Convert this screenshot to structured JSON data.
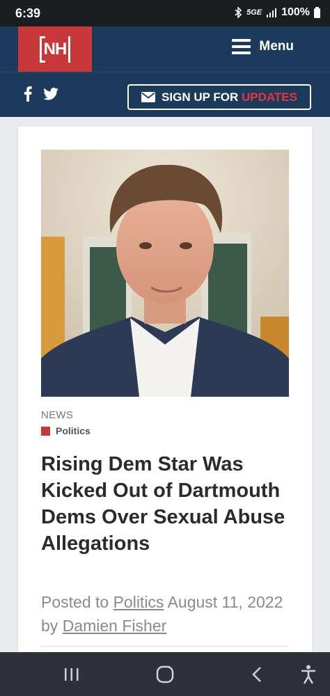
{
  "status": {
    "time": "6:39",
    "network": "5GE",
    "battery": "100%"
  },
  "header": {
    "logo_text": "NH",
    "menu_label": "Menu"
  },
  "subheader": {
    "signup_prefix": "SIGN UP FOR",
    "signup_highlight": "UPDATES"
  },
  "article": {
    "section": "NEWS",
    "category": "Politics",
    "headline": "Rising Dem Star Was Kicked Out of Dartmouth Dems Over Sexual Abuse Allegations",
    "posted_to": "Posted to",
    "category_link": "Politics",
    "date": "August 11, 2022",
    "by": "by",
    "author": "Damien Fisher"
  },
  "colors": {
    "brand_red": "#c8373a",
    "header_navy": "#1b3a5c"
  }
}
